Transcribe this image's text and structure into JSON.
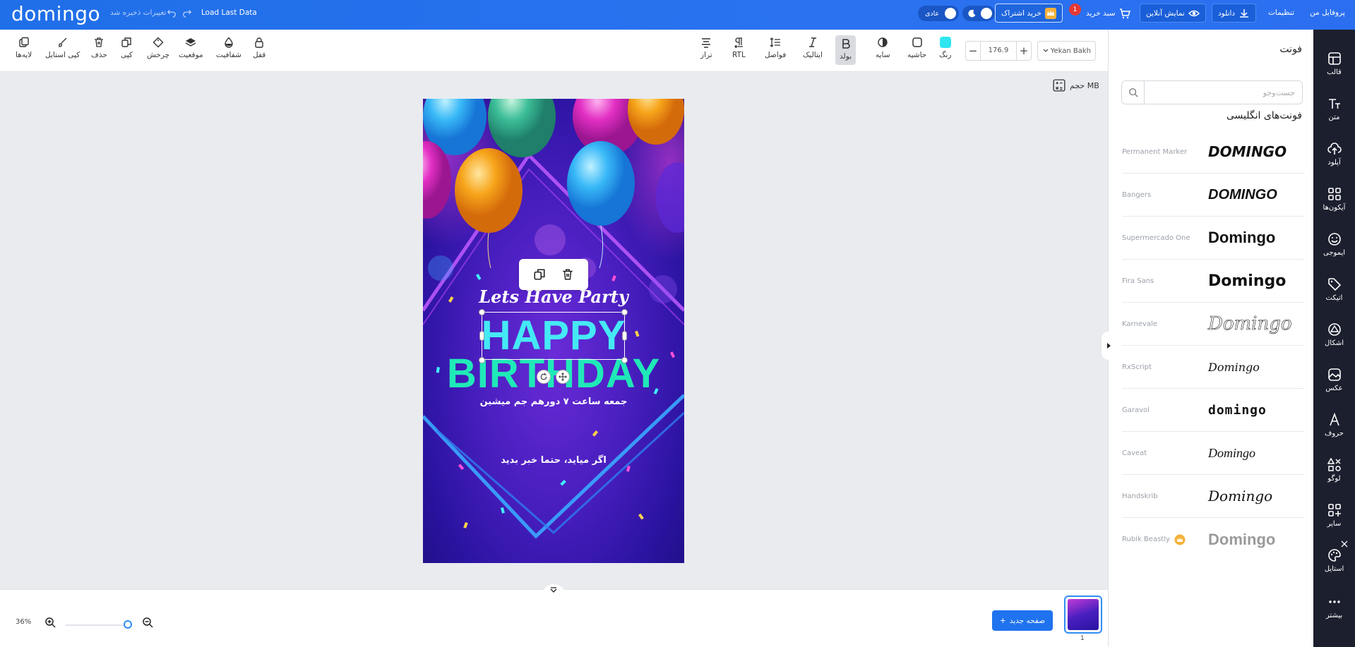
{
  "topbar": {
    "logo": "domingo",
    "saved_status": "تغییرات ذخیره شد",
    "load_last": "Load Last Data",
    "mode_label": "عادی",
    "buy_sub": "خرید اشتراک",
    "cart": "سبد خرید",
    "cart_count": "1",
    "preview": "نمایش آنلاین",
    "download": "دانلود",
    "settings": "تنظیمات",
    "profile": "پروفایل من"
  },
  "toolbar": {
    "layers": "لایه‌ها",
    "copy_style": "کپی استایل",
    "delete": "حذف",
    "copy": "کپی",
    "rotate": "چرخش",
    "position": "موقعیت",
    "opacity": "شفافیت",
    "lock": "قفل",
    "align": "تراز",
    "rtl": "RTL",
    "spacing": "فواصل",
    "italic": "ایتالیک",
    "bold": "بولد",
    "shadow": "سایه",
    "border": "حاشیه",
    "color": "رنگ",
    "color_hex": "#2ee6f0",
    "font_size": "176.9",
    "font_family": "Yekan Bakh"
  },
  "panel": {
    "title": "فونت",
    "search_placeholder": "جست‌وجو",
    "section": "فونت‌های انگلیسی",
    "fonts": [
      {
        "name": "Permanent Marker",
        "preview": "DOMINGO"
      },
      {
        "name": "Bangers",
        "preview": "DOMINGO"
      },
      {
        "name": "Supermercado One",
        "preview": "Domingo"
      },
      {
        "name": "Fira Sans",
        "preview": "Domingo"
      },
      {
        "name": "Karnevale",
        "preview": "Domingo"
      },
      {
        "name": "RxScript",
        "preview": "Domingo"
      },
      {
        "name": "Garavol",
        "preview": "domingo"
      },
      {
        "name": "Caveat",
        "preview": "Domingo"
      },
      {
        "name": "Handskrib",
        "preview": "Domingo"
      },
      {
        "name": "Rubik Beastly",
        "preview": "Domingo"
      }
    ]
  },
  "rail": {
    "template": "قالب",
    "text": "متن",
    "upload": "آپلود",
    "icons": "آیکون‌ها",
    "emoji": "ایموجی",
    "sticker": "اتیکت",
    "shapes": "اشکال",
    "photo": "عکس",
    "letters": "حروف",
    "logo": "لوگو",
    "other": "سایر",
    "style": "استایل",
    "more": "بیشتر"
  },
  "canvas": {
    "volume_label": "حجم MB",
    "line1": "Lets Have Party",
    "line2": "HAPPY",
    "line3": "BIRTHDAY",
    "line4": "جمعه ساعت ۷ دورهم جم میشین",
    "line5": "اگر میاید، حتما خبر بدید"
  },
  "bottom": {
    "zoom": "36%",
    "new_page": "صفحه جدید",
    "page_num": "1"
  }
}
